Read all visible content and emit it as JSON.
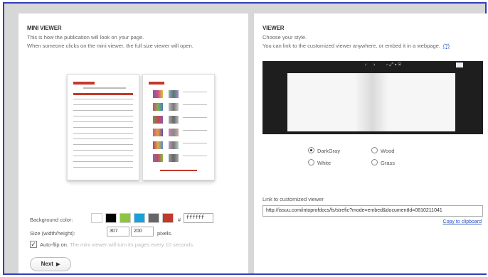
{
  "mini_viewer": {
    "title": "MINI VIEWER",
    "desc_line1": "This is how the publication will look on your page.",
    "desc_line2": "When someone clicks on the mini viewer, the full size viewer will open.",
    "background_label": "Background color:",
    "swatches": [
      "#ffffff",
      "#000000",
      "#8cc63f",
      "#1ba1d8",
      "#666666",
      "#c0392b"
    ],
    "hash": "#",
    "hex_value": "ffffff",
    "size_label": "Size (width/height):",
    "width_value": "307",
    "times": "x",
    "height_value": "200",
    "pixels_label": "pixels.",
    "autoflip_checked": "✓",
    "autoflip_label": "Auto-flip on.",
    "autoflip_note": "The mini viewer will turn its pages every 10 seconds.",
    "next_label": "Next",
    "next_icon": "▶"
  },
  "viewer": {
    "title": "VIEWER",
    "desc_line1": "Choose your style.",
    "desc_line2": "You can link to the customized viewer anywhere, or embed it in a webpage.",
    "help": "(?)",
    "toolbar": {
      "prev": "‹",
      "next": "›",
      "tools": "▫ ⤢ ▪ ✉"
    },
    "styles": [
      {
        "label": "DarkGray",
        "selected": true
      },
      {
        "label": "Wood",
        "selected": false
      },
      {
        "label": "White",
        "selected": false
      },
      {
        "label": "Grass",
        "selected": false
      }
    ],
    "link_label": "Link to customized viewer",
    "link_value": "http://issuu.com/intoprofdocs/fs/strefic?mode=embed&documentId=0810211041",
    "copy_label": "Copy to clipboard"
  }
}
